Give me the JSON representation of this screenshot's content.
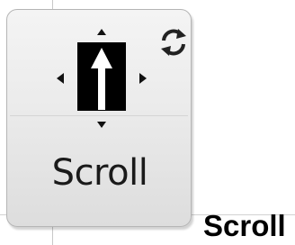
{
  "tile": {
    "label": "Scroll",
    "graphic_icon": "scroll-move-icon",
    "action_icon": "refresh-icon"
  },
  "caption": "Scroll"
}
